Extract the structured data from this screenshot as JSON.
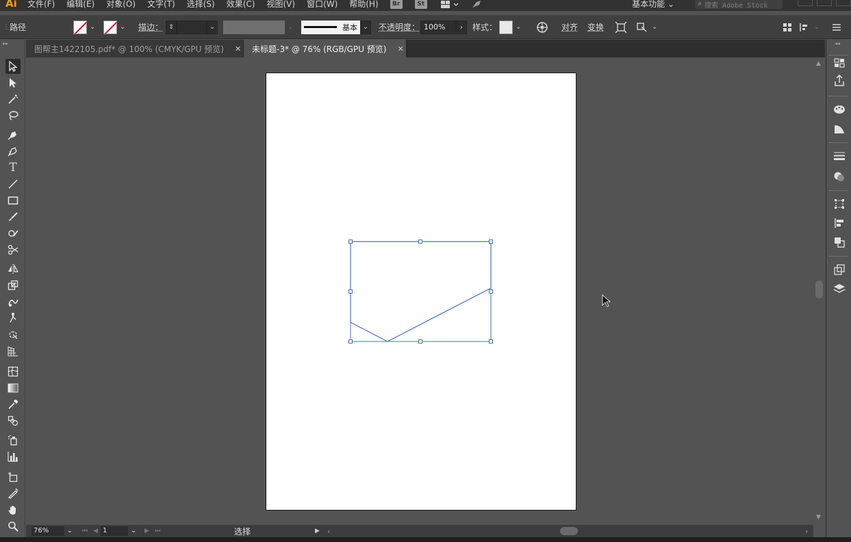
{
  "app": {
    "logo": "Ai"
  },
  "menu": [
    "文件(F)",
    "编辑(E)",
    "对象(O)",
    "文字(T)",
    "选择(S)",
    "效果(C)",
    "视图(V)",
    "窗口(W)",
    "帮助(H)"
  ],
  "menubar": {
    "bridge_badge": "Br",
    "stock_badge": "St",
    "workspace": "基本功能",
    "search_placeholder": "搜索 Adobe Stock"
  },
  "control": {
    "selection_type": "路径",
    "stroke_label": "描边：",
    "stroke_profile": "基本",
    "opacity_label": "不透明度：",
    "opacity_value": "100%",
    "style_label": "样式：",
    "align_label": "对齐",
    "transform_label": "变换"
  },
  "tabs": [
    {
      "label": "图帮主1422105.pdf* @ 100% (CMYK/GPU 预览)",
      "active": false
    },
    {
      "label": "未标题-3* @ 76% (RGB/GPU 预览)",
      "active": true
    }
  ],
  "tools": [
    "selection-tool",
    "direct-selection-tool",
    "magic-wand-tool",
    "lasso-tool",
    "pen-tool",
    "curvature-tool",
    "type-tool",
    "line-segment-tool",
    "rectangle-tool",
    "paintbrush-tool",
    "shaper-tool",
    "scissors-tool",
    "reflect-tool",
    "scale-tool",
    "warp-tool",
    "puppet-warp-tool",
    "free-transform-tool",
    "perspective-grid-tool",
    "mesh-tool",
    "gradient-tool",
    "eyedropper-tool",
    "blend-tool",
    "symbol-sprayer-tool",
    "column-graph-tool",
    "artboard-tool",
    "slice-tool",
    "hand-tool",
    "zoom-tool"
  ],
  "status": {
    "zoom": "76%",
    "artboard_number": "1",
    "current_tool": "选择"
  },
  "colors": {
    "selection": "#3e6fd8",
    "artboard": "#ffffff",
    "canvas": "#535353",
    "logo": "#ff9a00"
  }
}
